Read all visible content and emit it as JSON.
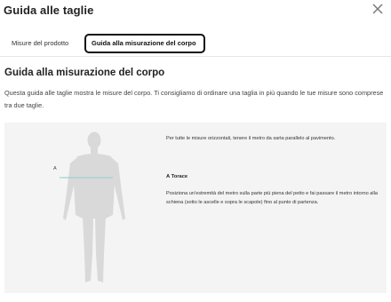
{
  "dialog": {
    "title": "Guida alle taglie",
    "close_icon": "close-icon"
  },
  "tabs": [
    {
      "label": "Misure del prodotto",
      "active": false
    },
    {
      "label": "Guida alla misurazione del corpo",
      "active": true
    }
  ],
  "content": {
    "heading": "Guida alla misurazione del corpo",
    "intro": "Questa guida alle taglie mostra le misure del corpo. Ti consigliamo di ordinare una taglia in più quando le tue misure sono comprese tra due taglie.",
    "figure": {
      "silhouette_icon": "body-silhouette-icon",
      "marker_label": "A",
      "measurement_line_color": "#9fd3cf",
      "note": "Per tutte le misure orizzontali, tenere il metro da sarta parallelo al pavimento.",
      "measurement": {
        "title": "A Torace",
        "description": "Posiziona un'estremità del metro sulla parte più piena del petto e fai passare il metro intorno alla schiena (sotto le ascelle e sopra le scapole) fino al punto di partenza."
      }
    }
  },
  "colors": {
    "panel_bg": "#f4f4f4",
    "silhouette": "#d9d9d9",
    "active_tab_border": "#111111"
  }
}
